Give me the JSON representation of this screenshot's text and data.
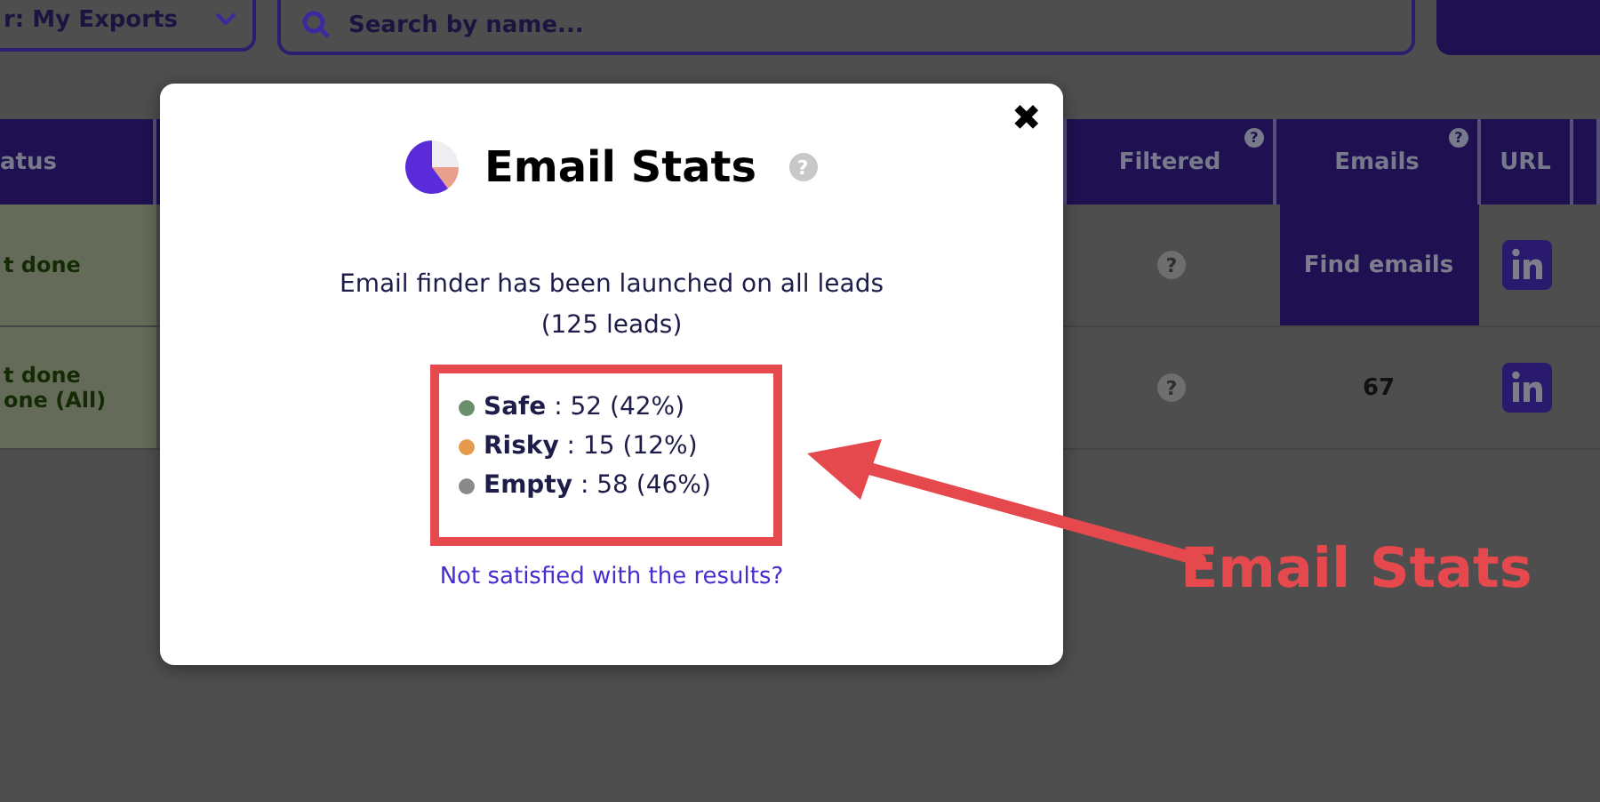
{
  "toolbar": {
    "folder_select": "r: My Exports",
    "search": {
      "placeholder": "Search by name..."
    }
  },
  "table": {
    "columns": [
      "atus",
      "Filtered",
      "Emails",
      "URL"
    ],
    "header_help": [
      "?",
      "?"
    ],
    "rows": [
      {
        "status": [
          "t done"
        ],
        "filtered_help": "?",
        "emails": {
          "kind": "button",
          "text": "Find emails"
        }
      },
      {
        "status": [
          "t done",
          "one (All)"
        ],
        "filtered_help": "?",
        "emails": {
          "kind": "count",
          "text": "67"
        }
      }
    ]
  },
  "modal": {
    "title": "Email Stats",
    "help": "?",
    "close": "✖",
    "message": "Email finder has been launched on all leads",
    "count": "(125 leads)",
    "stats": [
      {
        "label": "Safe",
        "value": " : 52 (42%)",
        "color": "#6b8e6b"
      },
      {
        "label": "Risky",
        "value": " : 15 (12%)",
        "color": "#e59a4c"
      },
      {
        "label": "Empty",
        "value": " : 58 (46%)",
        "color": "#8a8a8a"
      }
    ],
    "link": "Not satisfied with the results?"
  },
  "annotation": {
    "label": "Email Stats"
  }
}
